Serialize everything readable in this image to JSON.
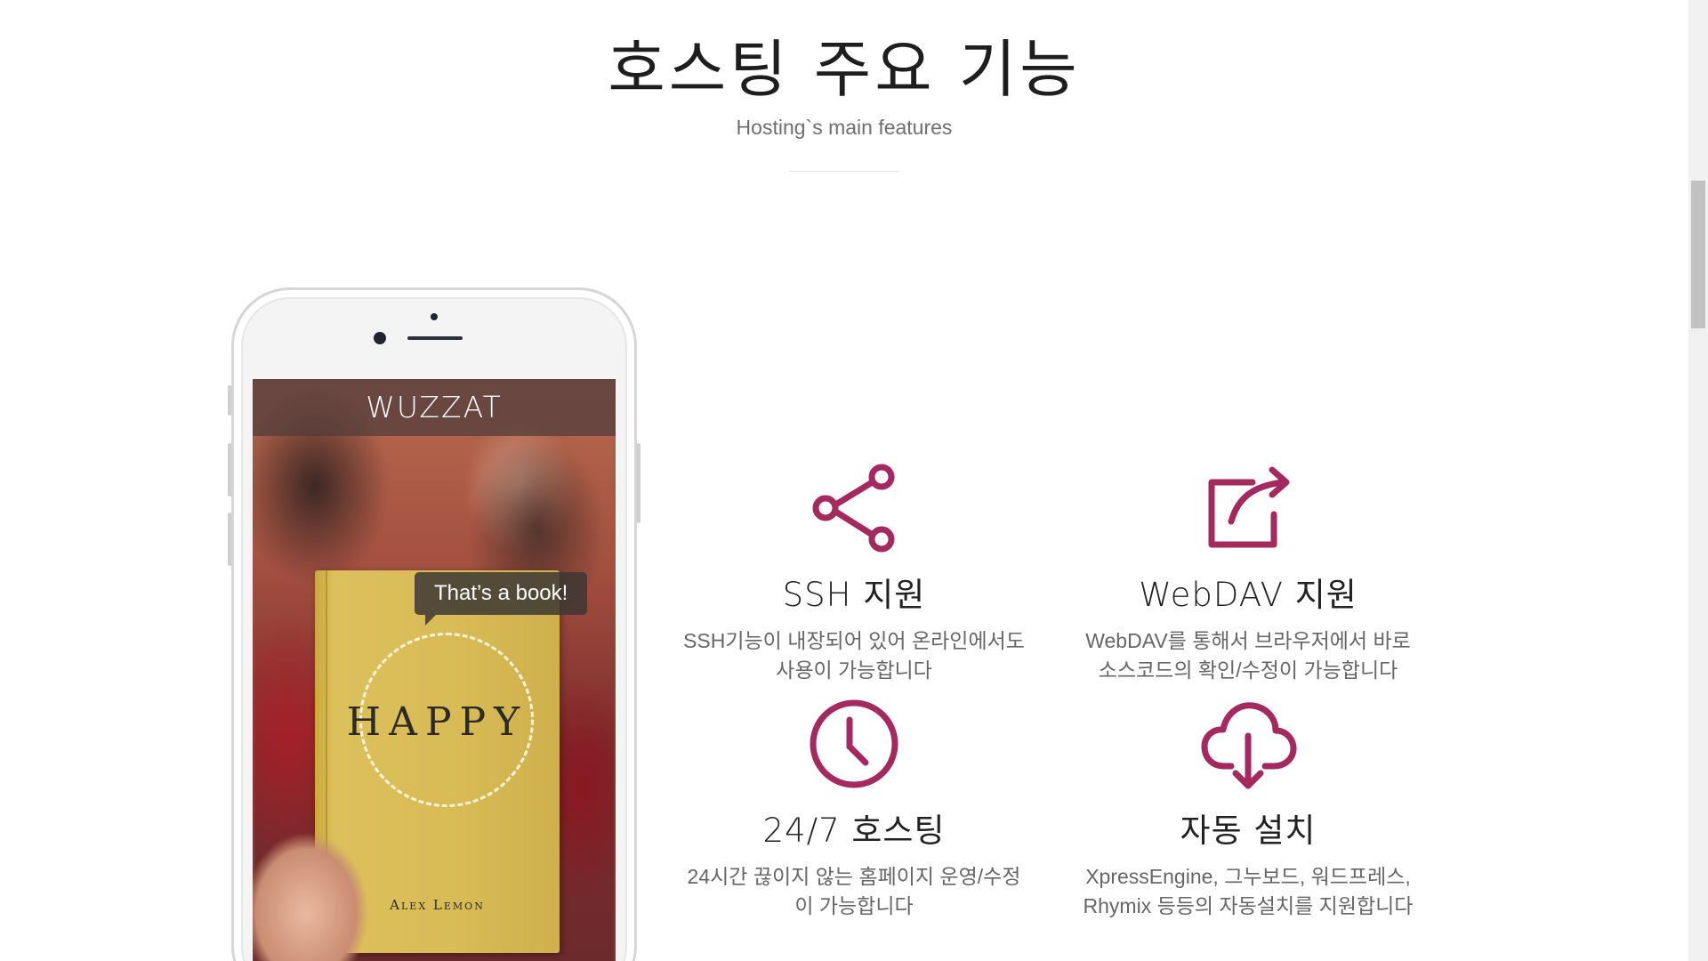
{
  "section": {
    "title": "호스팅 주요 기능",
    "subtitle": "Hosting`s main features"
  },
  "phone": {
    "app_title": "WUZZAT",
    "tooltip": "That’s a book!",
    "book_title": "HAPPY",
    "book_author": "Alex Lemon"
  },
  "features": [
    {
      "icon": "share-icon",
      "title": "SSH 지원",
      "desc_line1": "SSH기능이 내장되어 있어 온라인에서도",
      "desc_line2": "사용이 가능합니다"
    },
    {
      "icon": "external-link-icon",
      "title": "WebDAV 지원",
      "desc_line1": "WebDAV를 통해서 브라우저에서 바로",
      "desc_line2": "소스코드의 확인/수정이 가능합니다"
    },
    {
      "icon": "clock-icon",
      "title": "24/7 호스팅",
      "desc_line1": "24시간 끊이지 않는 홈페이지 운영/수정",
      "desc_line2": "이 가능합니다"
    },
    {
      "icon": "cloud-download-icon",
      "title": "자동 설치",
      "desc_line1": "XpressEngine, 그누보드, 워드프레스,",
      "desc_line2": "Rhymix 등등의 자동설치를 지원합니다"
    }
  ],
  "colors": {
    "accent": "#a3295f"
  }
}
